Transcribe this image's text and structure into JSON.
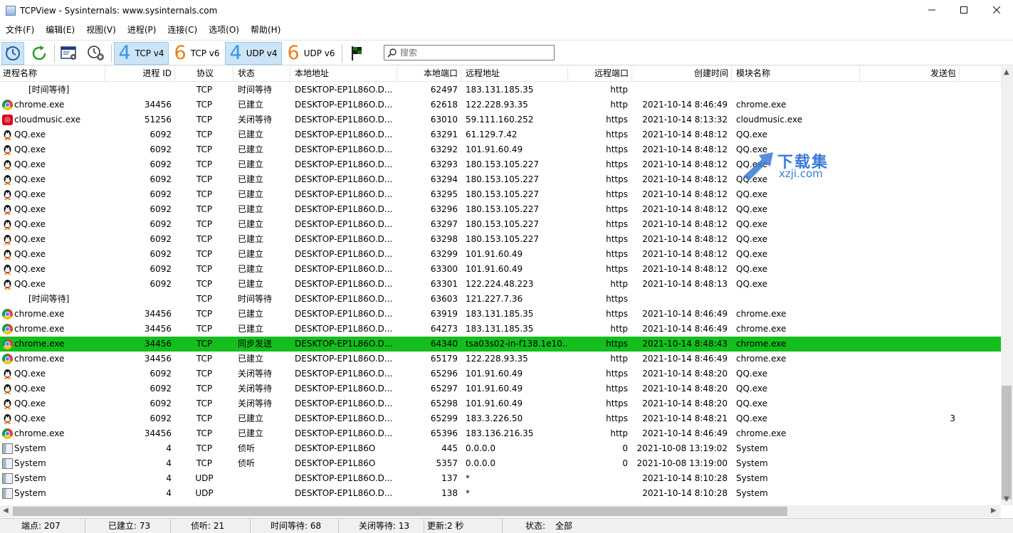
{
  "window": {
    "title": "TCPView - Sysinternals: www.sysinternals.com"
  },
  "menu": [
    "文件(F)",
    "编辑(E)",
    "视图(V)",
    "进程(P)",
    "连接(C)",
    "选项(O)",
    "帮助(H)"
  ],
  "toolbar": {
    "tcp4_num": "4",
    "tcp4_label": "TCP v4",
    "tcp6_num": "6",
    "tcp6_label": "TCP v6",
    "udp4_num": "4",
    "udp4_label": "UDP v4",
    "udp6_num": "6",
    "udp6_label": "UDP v6",
    "search_placeholder": "搜索"
  },
  "columns": [
    "进程名称",
    "进程 ID",
    "协议",
    "状态",
    "本地地址",
    "本地端口",
    "远程地址",
    "远程端口",
    "创建时间",
    "模块名称",
    "发送包"
  ],
  "rows": [
    {
      "icon": "none",
      "name": "[时间等待]",
      "pid": "",
      "proto": "TCP",
      "state": "时间等待",
      "laddr": "DESKTOP-EP1L86O.D...",
      "lport": "62497",
      "raddr": "183.131.185.35",
      "rport": "http",
      "ctime": "",
      "module": "",
      "sent": ""
    },
    {
      "icon": "chrome",
      "name": "chrome.exe",
      "pid": "34456",
      "proto": "TCP",
      "state": "已建立",
      "laddr": "DESKTOP-EP1L86O.D...",
      "lport": "62618",
      "raddr": "122.228.93.35",
      "rport": "http",
      "ctime": "2021-10-14 8:46:49",
      "module": "chrome.exe",
      "sent": ""
    },
    {
      "icon": "cloud",
      "name": "cloudmusic.exe",
      "pid": "51256",
      "proto": "TCP",
      "state": "关闭等待",
      "laddr": "DESKTOP-EP1L86O.D...",
      "lport": "63010",
      "raddr": "59.111.160.252",
      "rport": "https",
      "ctime": "2021-10-14 8:13:32",
      "module": "cloudmusic.exe",
      "sent": ""
    },
    {
      "icon": "qq",
      "name": "QQ.exe",
      "pid": "6092",
      "proto": "TCP",
      "state": "已建立",
      "laddr": "DESKTOP-EP1L86O.D...",
      "lport": "63291",
      "raddr": "61.129.7.42",
      "rport": "https",
      "ctime": "2021-10-14 8:48:12",
      "module": "QQ.exe",
      "sent": ""
    },
    {
      "icon": "qq",
      "name": "QQ.exe",
      "pid": "6092",
      "proto": "TCP",
      "state": "已建立",
      "laddr": "DESKTOP-EP1L86O.D...",
      "lport": "63292",
      "raddr": "101.91.60.49",
      "rport": "https",
      "ctime": "2021-10-14 8:48:12",
      "module": "QQ.exe",
      "sent": ""
    },
    {
      "icon": "qq",
      "name": "QQ.exe",
      "pid": "6092",
      "proto": "TCP",
      "state": "已建立",
      "laddr": "DESKTOP-EP1L86O.D...",
      "lport": "63293",
      "raddr": "180.153.105.227",
      "rport": "https",
      "ctime": "2021-10-14 8:48:12",
      "module": "QQ.exe",
      "sent": ""
    },
    {
      "icon": "qq",
      "name": "QQ.exe",
      "pid": "6092",
      "proto": "TCP",
      "state": "已建立",
      "laddr": "DESKTOP-EP1L86O.D...",
      "lport": "63294",
      "raddr": "180.153.105.227",
      "rport": "https",
      "ctime": "2021-10-14 8:48:12",
      "module": "QQ.exe",
      "sent": ""
    },
    {
      "icon": "qq",
      "name": "QQ.exe",
      "pid": "6092",
      "proto": "TCP",
      "state": "已建立",
      "laddr": "DESKTOP-EP1L86O.D...",
      "lport": "63295",
      "raddr": "180.153.105.227",
      "rport": "https",
      "ctime": "2021-10-14 8:48:12",
      "module": "QQ.exe",
      "sent": ""
    },
    {
      "icon": "qq",
      "name": "QQ.exe",
      "pid": "6092",
      "proto": "TCP",
      "state": "已建立",
      "laddr": "DESKTOP-EP1L86O.D...",
      "lport": "63296",
      "raddr": "180.153.105.227",
      "rport": "https",
      "ctime": "2021-10-14 8:48:12",
      "module": "QQ.exe",
      "sent": ""
    },
    {
      "icon": "qq",
      "name": "QQ.exe",
      "pid": "6092",
      "proto": "TCP",
      "state": "已建立",
      "laddr": "DESKTOP-EP1L86O.D...",
      "lport": "63297",
      "raddr": "180.153.105.227",
      "rport": "https",
      "ctime": "2021-10-14 8:48:12",
      "module": "QQ.exe",
      "sent": ""
    },
    {
      "icon": "qq",
      "name": "QQ.exe",
      "pid": "6092",
      "proto": "TCP",
      "state": "已建立",
      "laddr": "DESKTOP-EP1L86O.D...",
      "lport": "63298",
      "raddr": "180.153.105.227",
      "rport": "https",
      "ctime": "2021-10-14 8:48:12",
      "module": "QQ.exe",
      "sent": ""
    },
    {
      "icon": "qq",
      "name": "QQ.exe",
      "pid": "6092",
      "proto": "TCP",
      "state": "已建立",
      "laddr": "DESKTOP-EP1L86O.D...",
      "lport": "63299",
      "raddr": "101.91.60.49",
      "rport": "https",
      "ctime": "2021-10-14 8:48:12",
      "module": "QQ.exe",
      "sent": ""
    },
    {
      "icon": "qq",
      "name": "QQ.exe",
      "pid": "6092",
      "proto": "TCP",
      "state": "已建立",
      "laddr": "DESKTOP-EP1L86O.D...",
      "lport": "63300",
      "raddr": "101.91.60.49",
      "rport": "https",
      "ctime": "2021-10-14 8:48:12",
      "module": "QQ.exe",
      "sent": ""
    },
    {
      "icon": "qq",
      "name": "QQ.exe",
      "pid": "6092",
      "proto": "TCP",
      "state": "已建立",
      "laddr": "DESKTOP-EP1L86O.D...",
      "lport": "63301",
      "raddr": "122.224.48.223",
      "rport": "http",
      "ctime": "2021-10-14 8:48:13",
      "module": "QQ.exe",
      "sent": ""
    },
    {
      "icon": "none",
      "name": "[时间等待]",
      "pid": "",
      "proto": "TCP",
      "state": "时间等待",
      "laddr": "DESKTOP-EP1L86O.D...",
      "lport": "63603",
      "raddr": "121.227.7.36",
      "rport": "https",
      "ctime": "",
      "module": "",
      "sent": ""
    },
    {
      "icon": "chrome",
      "name": "chrome.exe",
      "pid": "34456",
      "proto": "TCP",
      "state": "已建立",
      "laddr": "DESKTOP-EP1L86O.D...",
      "lport": "63919",
      "raddr": "183.131.185.35",
      "rport": "https",
      "ctime": "2021-10-14 8:46:49",
      "module": "chrome.exe",
      "sent": ""
    },
    {
      "icon": "chrome",
      "name": "chrome.exe",
      "pid": "34456",
      "proto": "TCP",
      "state": "已建立",
      "laddr": "DESKTOP-EP1L86O.D...",
      "lport": "64273",
      "raddr": "183.131.185.35",
      "rport": "http",
      "ctime": "2021-10-14 8:46:49",
      "module": "chrome.exe",
      "sent": ""
    },
    {
      "icon": "chrome",
      "name": "chrome.exe",
      "pid": "34456",
      "proto": "TCP",
      "state": "同步发送",
      "laddr": "DESKTOP-EP1L86O.D...",
      "lport": "64340",
      "raddr": "tsa03s02-in-f138.1e10...",
      "rport": "https",
      "ctime": "2021-10-14 8:48:43",
      "module": "chrome.exe",
      "sent": "",
      "selected": true
    },
    {
      "icon": "chrome",
      "name": "chrome.exe",
      "pid": "34456",
      "proto": "TCP",
      "state": "已建立",
      "laddr": "DESKTOP-EP1L86O.D...",
      "lport": "65179",
      "raddr": "122.228.93.35",
      "rport": "http",
      "ctime": "2021-10-14 8:46:49",
      "module": "chrome.exe",
      "sent": ""
    },
    {
      "icon": "qq",
      "name": "QQ.exe",
      "pid": "6092",
      "proto": "TCP",
      "state": "关闭等待",
      "laddr": "DESKTOP-EP1L86O.D...",
      "lport": "65296",
      "raddr": "101.91.60.49",
      "rport": "https",
      "ctime": "2021-10-14 8:48:20",
      "module": "QQ.exe",
      "sent": ""
    },
    {
      "icon": "qq",
      "name": "QQ.exe",
      "pid": "6092",
      "proto": "TCP",
      "state": "关闭等待",
      "laddr": "DESKTOP-EP1L86O.D...",
      "lport": "65297",
      "raddr": "101.91.60.49",
      "rport": "https",
      "ctime": "2021-10-14 8:48:20",
      "module": "QQ.exe",
      "sent": ""
    },
    {
      "icon": "qq",
      "name": "QQ.exe",
      "pid": "6092",
      "proto": "TCP",
      "state": "关闭等待",
      "laddr": "DESKTOP-EP1L86O.D...",
      "lport": "65298",
      "raddr": "101.91.60.49",
      "rport": "https",
      "ctime": "2021-10-14 8:48:20",
      "module": "QQ.exe",
      "sent": ""
    },
    {
      "icon": "qq",
      "name": "QQ.exe",
      "pid": "6092",
      "proto": "TCP",
      "state": "已建立",
      "laddr": "DESKTOP-EP1L86O.D...",
      "lport": "65299",
      "raddr": "183.3.226.50",
      "rport": "https",
      "ctime": "2021-10-14 8:48:21",
      "module": "QQ.exe",
      "sent": "3"
    },
    {
      "icon": "chrome",
      "name": "chrome.exe",
      "pid": "34456",
      "proto": "TCP",
      "state": "已建立",
      "laddr": "DESKTOP-EP1L86O.D...",
      "lport": "65396",
      "raddr": "183.136.216.35",
      "rport": "http",
      "ctime": "2021-10-14 8:46:49",
      "module": "chrome.exe",
      "sent": ""
    },
    {
      "icon": "sys",
      "name": "System",
      "pid": "4",
      "proto": "TCP",
      "state": "侦听",
      "laddr": "DESKTOP-EP1L86O",
      "lport": "445",
      "raddr": "0.0.0.0",
      "rport": "0",
      "ctime": "2021-10-08 13:19:02",
      "module": "System",
      "sent": ""
    },
    {
      "icon": "sys",
      "name": "System",
      "pid": "4",
      "proto": "TCP",
      "state": "侦听",
      "laddr": "DESKTOP-EP1L86O",
      "lport": "5357",
      "raddr": "0.0.0.0",
      "rport": "0",
      "ctime": "2021-10-08 13:19:00",
      "module": "System",
      "sent": ""
    },
    {
      "icon": "sys",
      "name": "System",
      "pid": "4",
      "proto": "UDP",
      "state": "",
      "laddr": "DESKTOP-EP1L86O.D...",
      "lport": "137",
      "raddr": "*",
      "rport": "",
      "ctime": "2021-10-14 8:10:28",
      "module": "System",
      "sent": ""
    },
    {
      "icon": "sys",
      "name": "System",
      "pid": "4",
      "proto": "UDP",
      "state": "",
      "laddr": "DESKTOP-EP1L86O.D...",
      "lport": "138",
      "raddr": "*",
      "rport": "",
      "ctime": "2021-10-14 8:10:28",
      "module": "System",
      "sent": ""
    }
  ],
  "status": {
    "endpoints": "端点: 207",
    "established": "已建立: 73",
    "listening": "侦听: 21",
    "time_wait": "时间等待: 68",
    "close_wait": "关闭等待: 13",
    "update": "更新:2 秒",
    "state_label": "状态:",
    "state_value": "全部"
  },
  "watermark": {
    "big": "下载集",
    "small": "xzji.com"
  },
  "colors": {
    "selected_row": "#14be1c",
    "toolbar_active": "#cce4f7",
    "ipv4_blue": "#3a96dd",
    "ipv6_orange": "#e8821e"
  }
}
